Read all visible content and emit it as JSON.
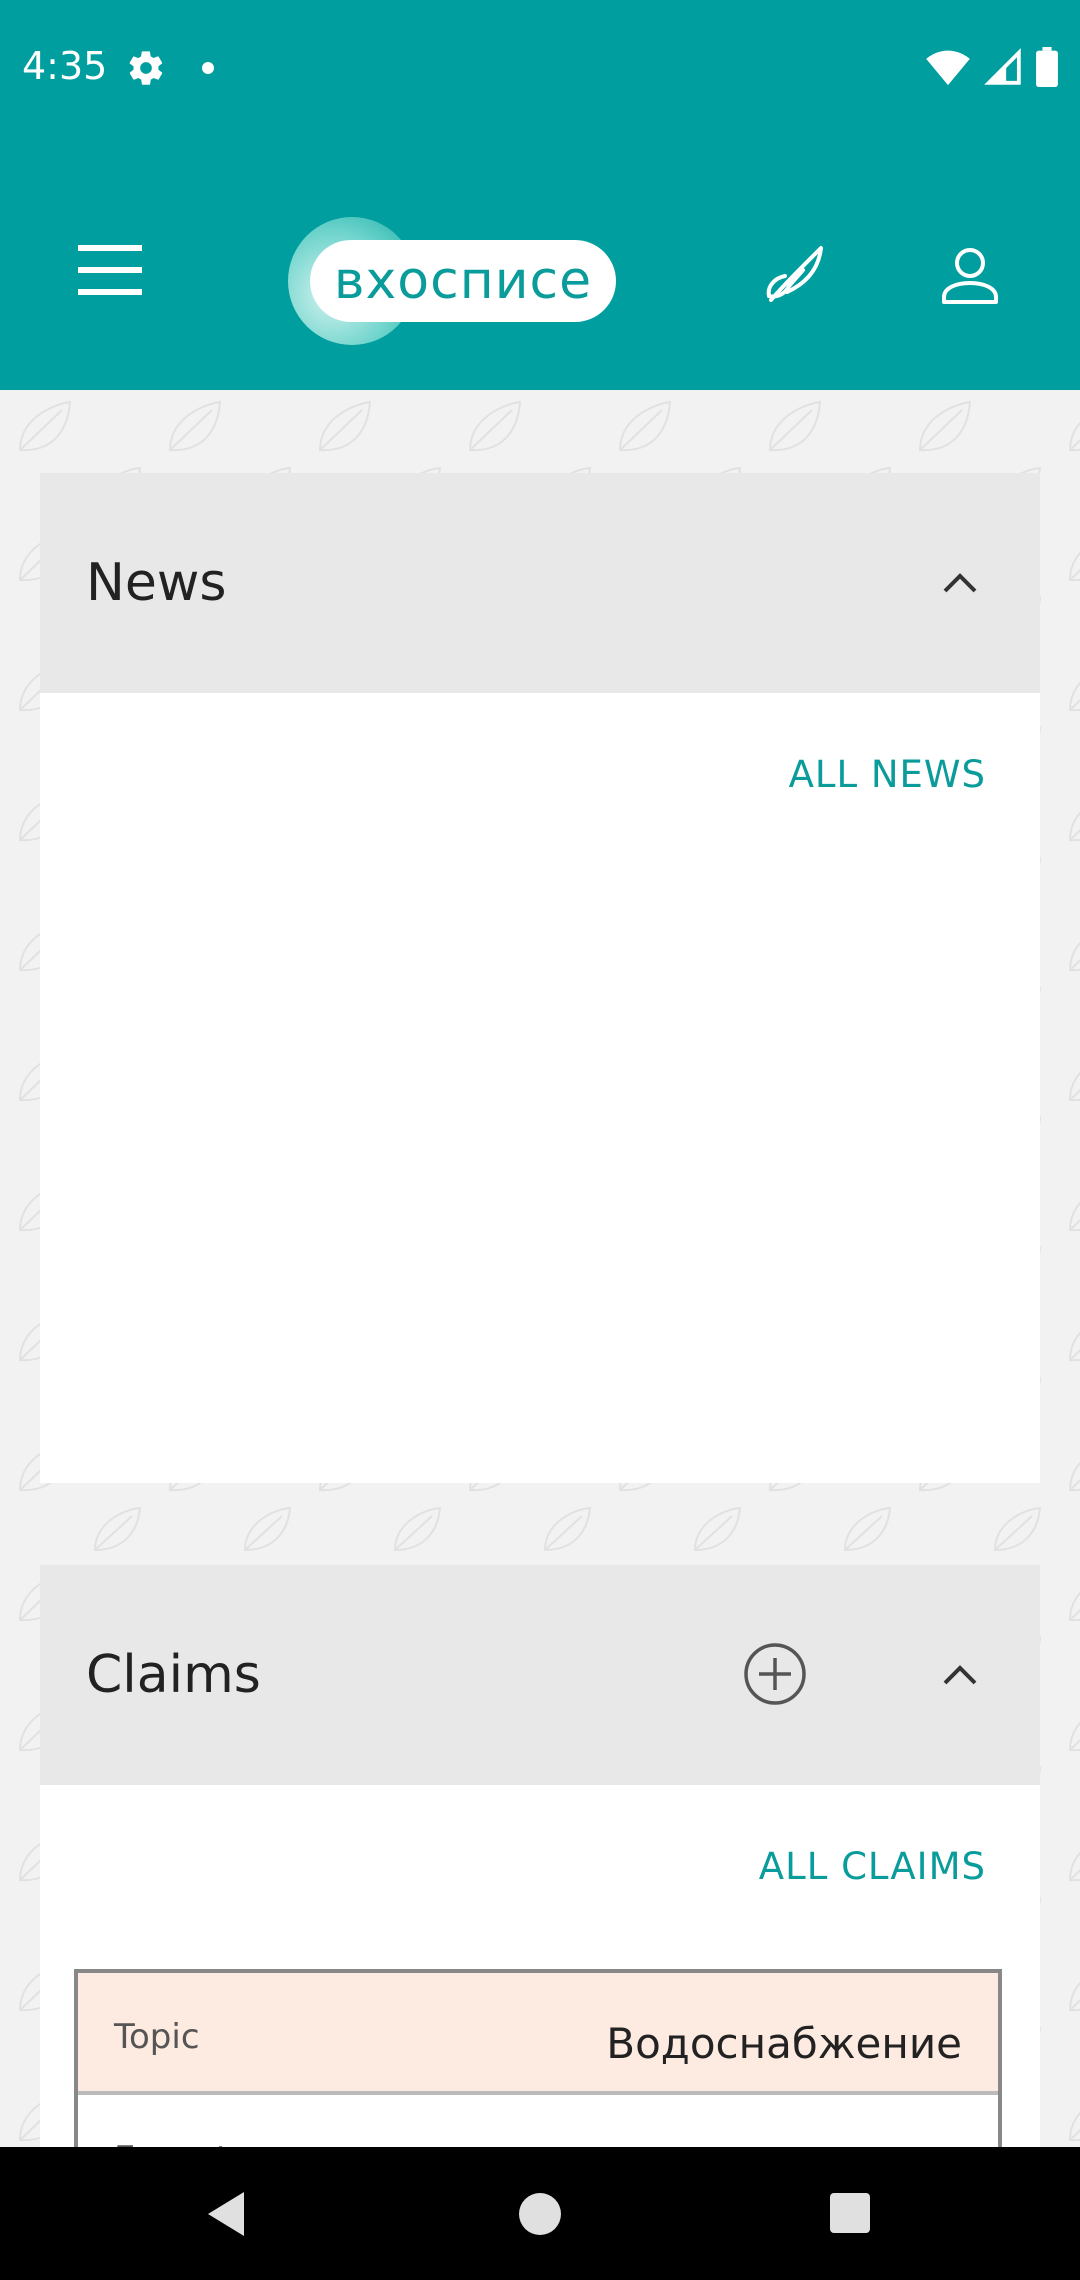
{
  "status_bar": {
    "time": "4:35",
    "icons": [
      "gear-icon",
      "notification-dot-icon",
      "wifi-icon",
      "cell-signal-icon",
      "battery-icon"
    ]
  },
  "app_bar": {
    "logo_text": "вхосписе",
    "icons": [
      "menu-icon",
      "feather-icon",
      "profile-icon"
    ],
    "brand_color": "#009e9e"
  },
  "news": {
    "title": "News",
    "all_link": "ALL NEWS",
    "expanded": true
  },
  "claims": {
    "title": "Claims",
    "all_link": "ALL CLAIMS",
    "expanded": true,
    "items": [
      {
        "topic_label": "Topic",
        "topic_value": "Водоснабжение",
        "executor_label": "Executor"
      }
    ]
  },
  "colors": {
    "accent": "#009e9e",
    "link": "#0a9b9b",
    "topic_bg": "#fdeae0"
  }
}
